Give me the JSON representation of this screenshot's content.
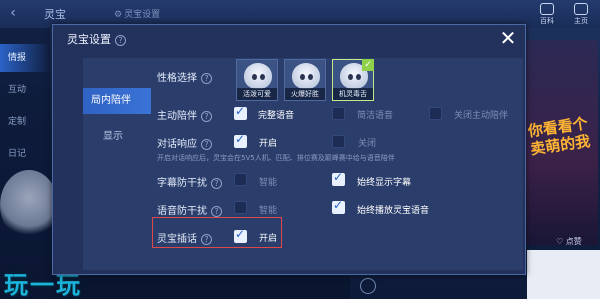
{
  "background": {
    "title": "灵宝",
    "settings_link": "灵宝设置",
    "right_icons": [
      "百科",
      "主页"
    ],
    "sidebar": [
      "情报",
      "互动",
      "定制",
      "日记"
    ],
    "card_text": "你看看个卖萌的我",
    "like_label": "点赞",
    "watermark": "玩一玩"
  },
  "dialog": {
    "title": "灵宝设置",
    "close_icon": "close-icon",
    "tabs": [
      {
        "label": "局内陪伴",
        "active": true
      },
      {
        "label": "显示",
        "active": false
      }
    ],
    "personality": {
      "label": "性格选择",
      "options": [
        {
          "caption": "活泼可爱",
          "selected": false
        },
        {
          "caption": "火爆好胜",
          "selected": false
        },
        {
          "caption": "机灵毒舌",
          "selected": true
        }
      ]
    },
    "active_companion": {
      "label": "主动陪伴",
      "options": [
        {
          "label": "完整语音",
          "checked": true
        },
        {
          "label": "简洁语音",
          "checked": false
        },
        {
          "label": "关闭主动陪伴",
          "checked": false
        }
      ]
    },
    "dialog_response": {
      "label": "对话响应",
      "options": [
        {
          "label": "开启",
          "checked": true
        },
        {
          "label": "关闭",
          "checked": false
        }
      ],
      "hint": "开启对话响应后，灵宝会在5V5人机、匹配、排位赛及巅峰赛中给与语音陪伴"
    },
    "subtitle_antidisturb": {
      "label": "字幕防干扰",
      "options": [
        {
          "label": "智能",
          "checked": false
        },
        {
          "label": "始终显示字幕",
          "checked": true
        }
      ]
    },
    "voice_antidisturb": {
      "label": "语音防干扰",
      "options": [
        {
          "label": "智能",
          "checked": false
        },
        {
          "label": "始终播放灵宝语音",
          "checked": true
        }
      ]
    },
    "lingbao_interject": {
      "label": "灵宝插话",
      "options": [
        {
          "label": "开启",
          "checked": true
        }
      ]
    }
  },
  "colors": {
    "accent": "#2f63c4",
    "highlight": "#e04848",
    "selected_border": "#c6e88a"
  }
}
